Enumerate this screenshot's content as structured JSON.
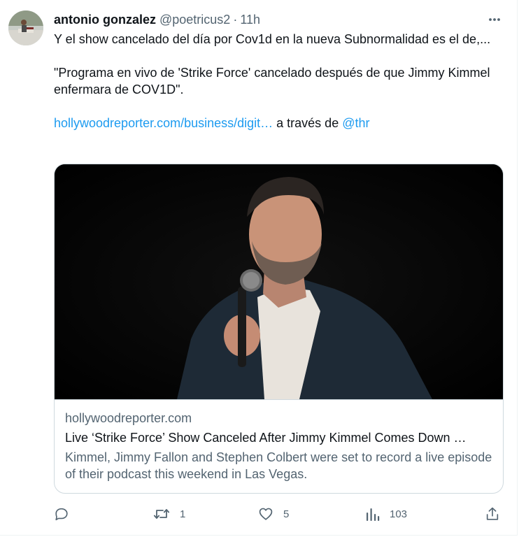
{
  "tweet": {
    "author": {
      "display_name": "antonio gonzalez",
      "handle": "@poetricus2",
      "separator": "·",
      "time": "11h"
    },
    "text": {
      "line1": "Y el show cancelado del día por Cov1d en la nueva Subnormalidad es el de,...",
      "line2": "\"Programa en vivo de 'Strike Force' cancelado después de que Jimmy Kimmel enfermara de COV1D\".",
      "link": "hollywoodreporter.com/business/digit…",
      "via": " a través de ",
      "mention": "@thr"
    },
    "card": {
      "domain": "hollywoodreporter.com",
      "title": "Live ‘Strike Force’ Show Canceled After Jimmy Kimmel Comes Down …",
      "description": "Kimmel, Jimmy Fallon and Stephen Colbert were set to record a live episode of their podcast this weekend in Las Vegas.",
      "image_icon": "photo-man-with-microphone"
    },
    "actions": {
      "reply_count": "",
      "retweet_count": "1",
      "like_count": "5",
      "views_count": "103"
    }
  },
  "colors": {
    "text": "#0f1419",
    "secondary": "#536471",
    "link": "#1d9bf0",
    "border": "#cfd9de"
  }
}
